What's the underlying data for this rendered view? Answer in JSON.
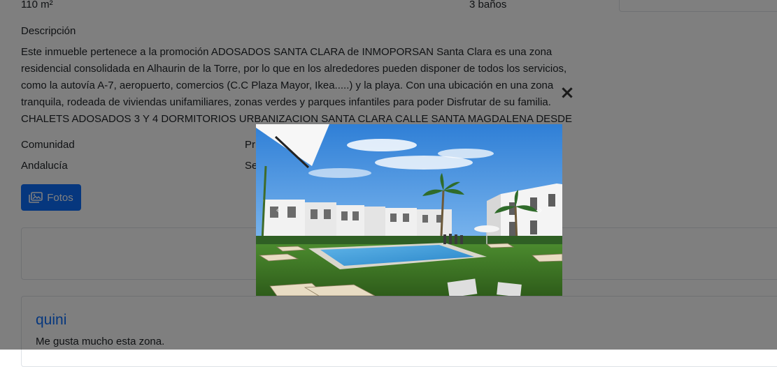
{
  "details": {
    "area": "110 m²",
    "bathrooms": "3 baños",
    "description_label": "Descripción",
    "description_lines": [
      "Este inmueble pertenece a la promoción ADOSADOS SANTA CLARA de INMOPORSAN Santa Clara es una zona",
      "residencial consolidada en Alhaurin de la Torre, por lo que en los alrededores pueden disponer de todos los servicios,",
      "como la autovía A-7, aeropuerto, comercios (C.C Plaza Mayor, Ikea.....) y la playa. Con una ubicación en una zona",
      "tranquila, rodeada de viviendas unifamiliares, zonas verdes y parques infantiles para poder Disfrutar de su familia.",
      "CHALETS ADOSADOS 3 Y 4 DORMITORIOS URBANIZACION SANTA CLARA CALLE SANTA MAGDALENA DESDE"
    ],
    "community_label": "Comunidad",
    "community_value": "Andalucía",
    "province_label_partial": "Pr",
    "second_value_partial": "Se"
  },
  "photos_button": {
    "label": "Fotos",
    "icon": "images-icon"
  },
  "comment": {
    "author": "quini",
    "text": "Me gusta mucho esta zona."
  },
  "lightbox": {
    "close_icon": "×",
    "prev_icon": "‹",
    "next_icon": "›"
  }
}
